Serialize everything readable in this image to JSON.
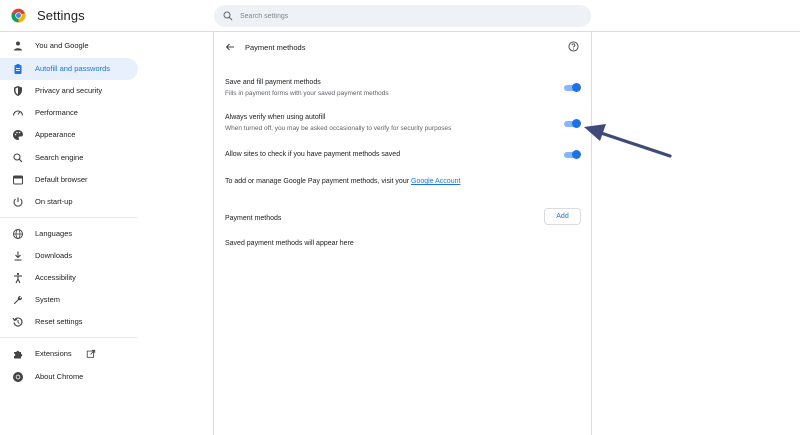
{
  "header": {
    "title": "Settings",
    "search_placeholder": "Search settings"
  },
  "sidebar": {
    "items": [
      {
        "label": "You and Google",
        "icon": "person-icon"
      },
      {
        "label": "Autofill and passwords",
        "icon": "clipboard-icon",
        "active": true
      },
      {
        "label": "Privacy and security",
        "icon": "shield-icon"
      },
      {
        "label": "Performance",
        "icon": "speedometer-icon"
      },
      {
        "label": "Appearance",
        "icon": "palette-icon"
      },
      {
        "label": "Search engine",
        "icon": "search-icon"
      },
      {
        "label": "Default browser",
        "icon": "browser-icon"
      },
      {
        "label": "On start-up",
        "icon": "power-icon"
      },
      {
        "label": "Languages",
        "icon": "globe-icon"
      },
      {
        "label": "Downloads",
        "icon": "download-icon"
      },
      {
        "label": "Accessibility",
        "icon": "accessibility-icon"
      },
      {
        "label": "System",
        "icon": "wrench-icon"
      },
      {
        "label": "Reset settings",
        "icon": "reset-icon"
      },
      {
        "label": "Extensions",
        "icon": "puzzle-icon"
      },
      {
        "label": "About Chrome",
        "icon": "chrome-icon"
      }
    ]
  },
  "main": {
    "page_title": "Payment methods",
    "rows": [
      {
        "title": "Save and fill payment methods",
        "subtitle": "Fills in payment forms with your saved payment methods",
        "enabled": true
      },
      {
        "title": "Always verify when using autofill",
        "subtitle": "When turned off, you may be asked occasionally to verify for security purposes",
        "enabled": true
      },
      {
        "title": "Allow sites to check if you have payment methods saved",
        "subtitle": "",
        "enabled": true
      }
    ],
    "gpay_text": "To add or manage Google Pay payment methods, visit your ",
    "gpay_link": "Google Account",
    "section_label": "Payment methods",
    "add_label": "Add",
    "empty_text": "Saved payment methods will appear here"
  },
  "colors": {
    "accent": "#1a73e8",
    "active_bg": "#e8f0fe",
    "annotation_arrow": "#3f4a7a"
  }
}
